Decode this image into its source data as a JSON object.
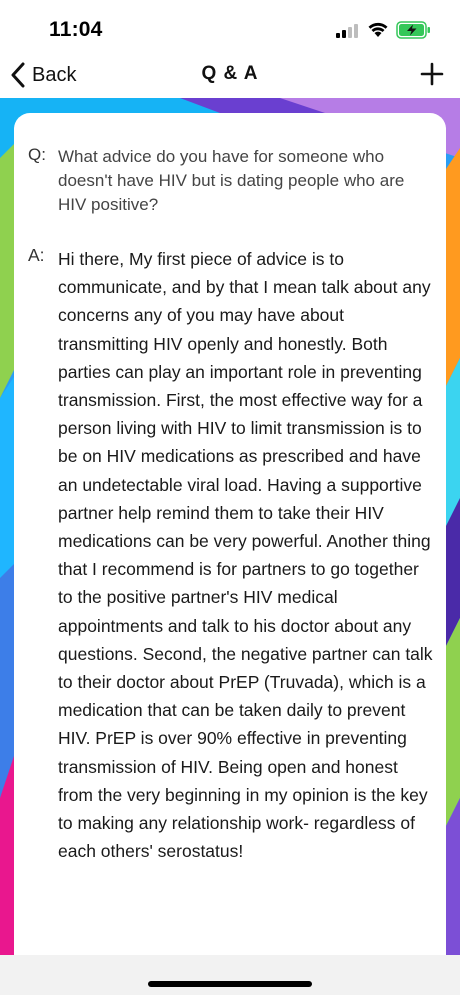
{
  "status_bar": {
    "time": "11:04"
  },
  "nav": {
    "back_label": "Back",
    "title": "Q & A",
    "add_icon": "plus-icon"
  },
  "qa": {
    "question_prefix": "Q:",
    "question": "What advice do you have for someone who doesn't have HIV but is dating people who are HIV positive?",
    "answer_prefix": "A:",
    "answer": "Hi there, My first piece of advice is to communicate, and by that I mean talk about any concerns any of you may have about transmitting HIV openly and honestly. Both parties can play an important role in preventing transmission. First, the most effective way for a person living with HIV to limit transmission is to be on HIV medications as prescribed and have an undetectable viral load. Having a supportive partner help remind them to take their HIV medications can be very powerful. Another thing that I recommend is for partners to go together to the positive partner's HIV medical appointments and talk to his doctor about any questions. Second, the negative partner can talk to their doctor about PrEP (Truvada), which is a medication that can be taken daily to prevent HIV. PrEP is over 90% effective in preventing transmission of HIV. Being open and honest from the very beginning in my opinion is the key to making any relationship work- regardless of each others' serostatus!"
  },
  "colors": {
    "battery_green": "#34c759",
    "background_stripes": [
      "#ff3aa8",
      "#8fd14f",
      "#1fb6ff",
      "#5e2bd6",
      "#ff9a1f",
      "#3bd4f0",
      "#e91e8c"
    ]
  }
}
